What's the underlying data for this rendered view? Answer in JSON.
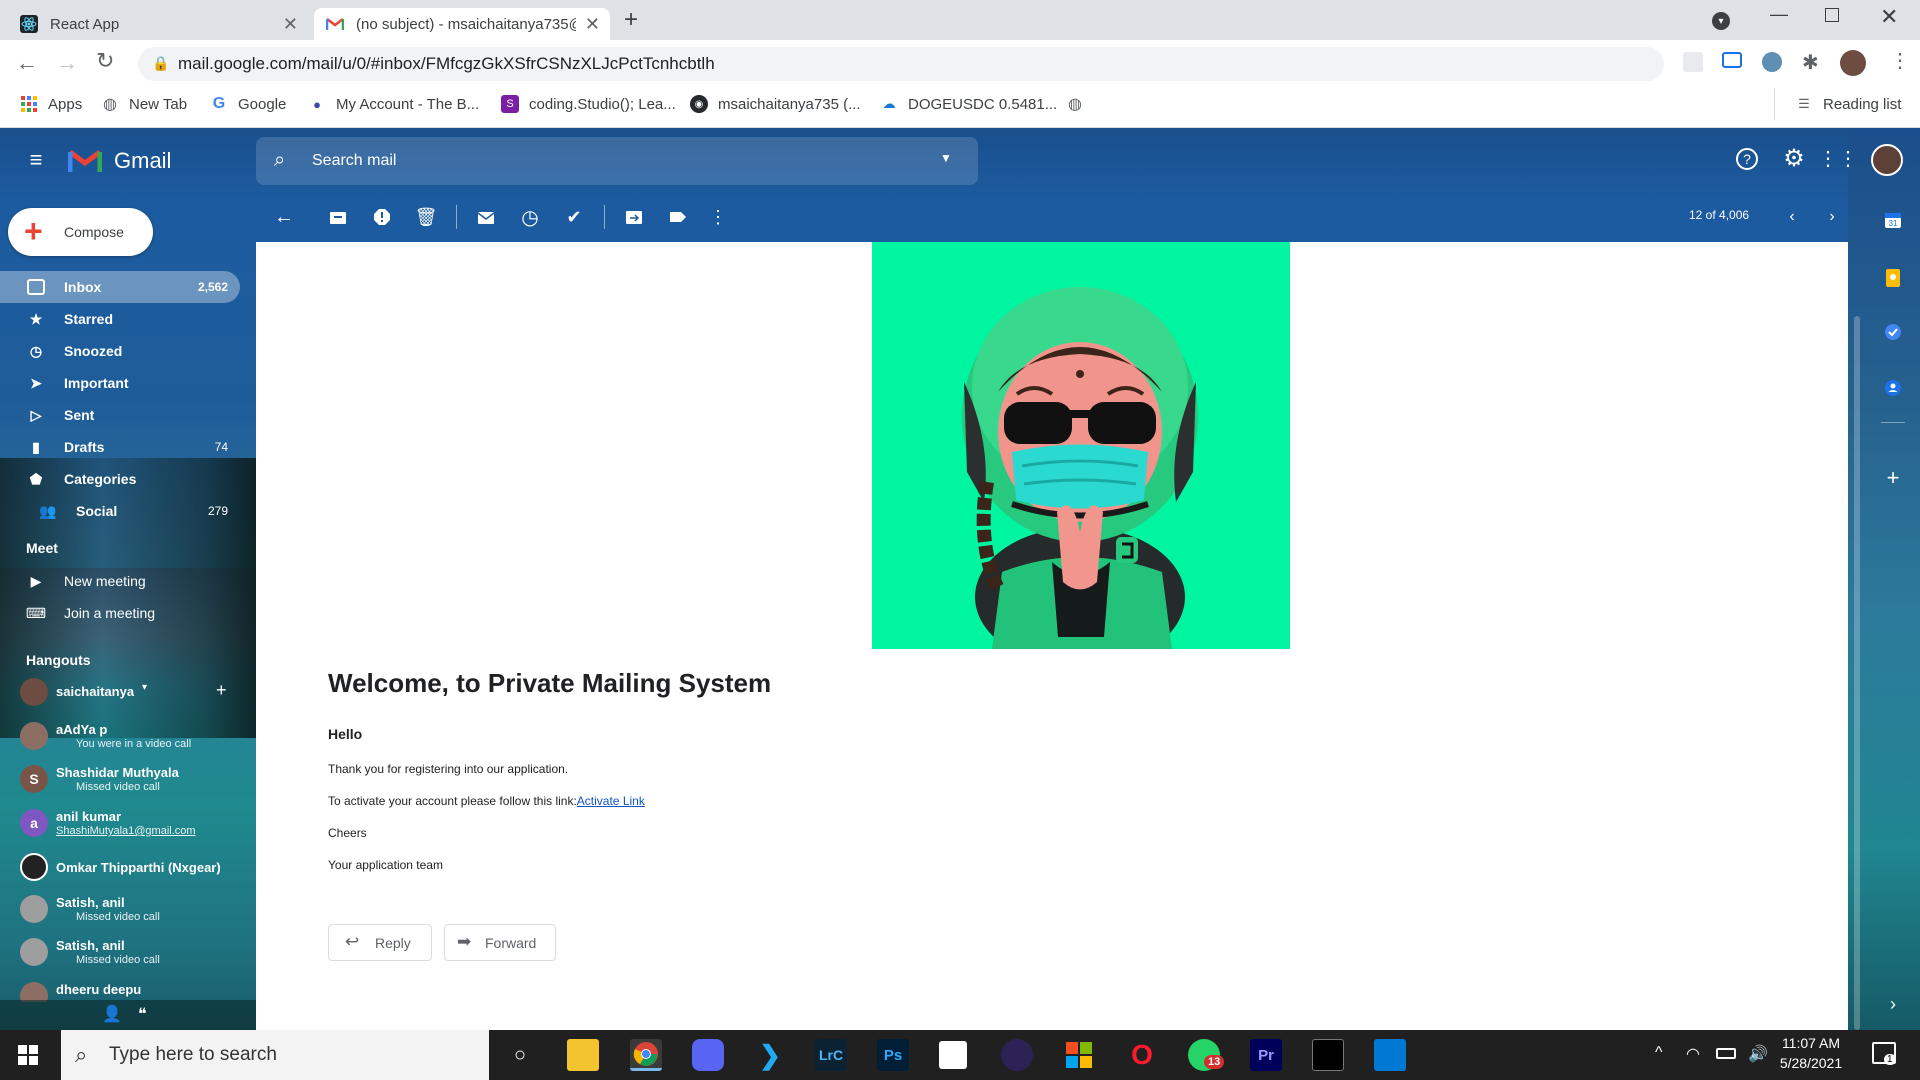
{
  "browser": {
    "tabs": [
      {
        "title": "React App",
        "icon": "react-icon"
      },
      {
        "title": "(no subject) - msaichaitanya735@",
        "icon": "gmail-icon"
      }
    ],
    "new_tab": "+",
    "url": "mail.google.com/mail/u/0/#inbox/FMfcgzGkXSfrCSNzXLJcPctTcnhcbtlh",
    "bookmarks": [
      {
        "label": "Apps"
      },
      {
        "label": "New Tab"
      },
      {
        "label": "Google"
      },
      {
        "label": "My Account - The B..."
      },
      {
        "label": "coding.Studio(); Lea..."
      },
      {
        "label": "msaichaitanya735 (..."
      },
      {
        "label": "DOGEUSDC 0.5481..."
      }
    ],
    "reading_list": "Reading list"
  },
  "gmail": {
    "logo_text": "Gmail",
    "search_placeholder": "Search mail",
    "compose_label": "Compose",
    "nav": [
      {
        "label": "Inbox",
        "count": "2,562",
        "icon": "inbox-icon"
      },
      {
        "label": "Starred",
        "count": "",
        "icon": "star-icon"
      },
      {
        "label": "Snoozed",
        "count": "",
        "icon": "clock-icon"
      },
      {
        "label": "Important",
        "count": "",
        "icon": "important-icon"
      },
      {
        "label": "Sent",
        "count": "",
        "icon": "send-icon"
      },
      {
        "label": "Drafts",
        "count": "74",
        "icon": "draft-icon"
      },
      {
        "label": "Categories",
        "count": "",
        "icon": "label-icon"
      },
      {
        "label": "Social",
        "count": "279",
        "icon": "people-icon"
      }
    ],
    "meet": {
      "title": "Meet",
      "new_meeting": "New meeting",
      "join_meeting": "Join a meeting"
    },
    "hangouts": {
      "title": "Hangouts",
      "me": "saichaitanya",
      "contacts": [
        {
          "name": "aAdYa p",
          "status": "You were in a video call",
          "initial": "",
          "color": "#8d6e63"
        },
        {
          "name": "Shashidar Muthyala",
          "status": "Missed video call",
          "initial": "S",
          "color": "#795548"
        },
        {
          "name": "anil kumar",
          "status": "ShashiMutyala1@gmail.com",
          "initial": "a",
          "color": "#7e57c2"
        },
        {
          "name": "Omkar Thipparthi (Nxgear)",
          "status": "",
          "initial": "",
          "color": "#222222"
        },
        {
          "name": "Satish, anil",
          "status": "Missed video call",
          "initial": "",
          "color": "#9e9e9e"
        },
        {
          "name": "Satish, anil",
          "status": "Missed video call",
          "initial": "",
          "color": "#9e9e9e"
        },
        {
          "name": "dheeru deepu",
          "status": "",
          "initial": "",
          "color": "#8d6e63"
        }
      ]
    },
    "pagination": "12 of 4,006",
    "message": {
      "heading": "Welcome, to Private Mailing System",
      "greeting": "Hello",
      "line1": "Thank you for registering into our application.",
      "line2_prefix": "To activate your account please follow this link:",
      "link_text": "Activate Link",
      "closing": "Cheers",
      "signature": "Your application team",
      "reply_label": "Reply",
      "forward_label": "Forward"
    },
    "colors": {
      "accent_link": "#1a0dab",
      "hero_bg": "#00f5a0",
      "header_blue": "#1a4f8c"
    }
  },
  "taskbar": {
    "search_placeholder": "Type here to search",
    "time": "11:07 AM",
    "date": "5/28/2021",
    "whatsapp_badge": "13",
    "notification_count": "1"
  }
}
